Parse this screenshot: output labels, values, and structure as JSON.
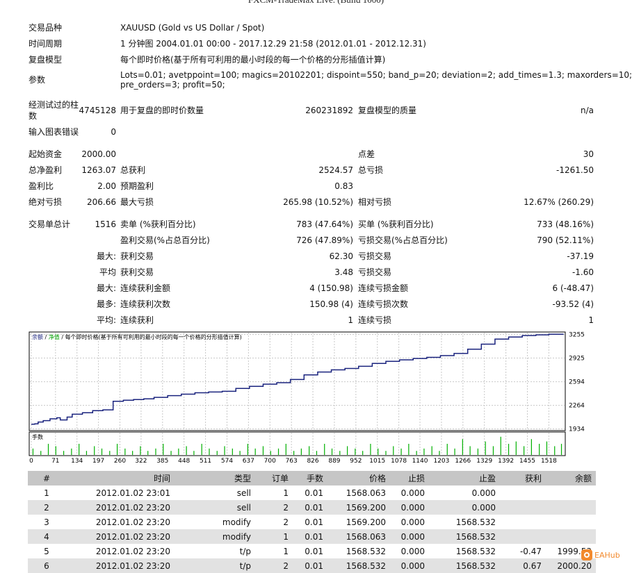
{
  "header": {
    "title": "FXCM-TradeMax Live. (Build 1000)"
  },
  "info": {
    "symbol_label": "交易品种",
    "symbol_value": "XAUUSD (Gold vs US Dollar / Spot)",
    "period_label": "时间周期",
    "period_value": "1 分钟图 2004.01.01 00:00 - 2017.12.29 21:58 (2012.01.01 - 2012.12.31)",
    "model_label": "复盘模型",
    "model_value": "每个即时价格(基于所有可利用的最小时段的每一个价格的分形插值计算)",
    "params_label": "参数",
    "params_line1": "Lots=0.01; avetppoint=100; magics=20102201; dispoint=550; band_p=20; deviation=2; add_times=1.3; maxorders=10;",
    "params_line2": "pre_orders=3; profit=50;"
  },
  "stats": {
    "bars_label_1": "经测试过的柱",
    "bars_label_2": "数",
    "bars_value": "4745128",
    "ticks_label": "用于复盘的即时价数量",
    "ticks_value": "260231892",
    "quality_label": "复盘模型的质量",
    "quality_value": "n/a",
    "errors_label": "输入图表错误",
    "errors_value": "0",
    "deposit_label": "起始资金",
    "deposit_value": "2000.00",
    "spread_label": "点差",
    "spread_value": "30",
    "net_label": "总净盈利",
    "net_value": "1263.07",
    "gross_profit_label": "总获利",
    "gross_profit_value": "2524.57",
    "gross_loss_label": "总亏损",
    "gross_loss_value": "-1261.50",
    "pf_label": "盈利比",
    "pf_value": "2.00",
    "payoff_label": "预期盈利",
    "payoff_value": "0.83",
    "abs_dd_label": "绝对亏损",
    "abs_dd_value": "206.66",
    "max_dd_label": "最大亏损",
    "max_dd_value": "265.98 (10.52%)",
    "rel_dd_label": "相对亏损",
    "rel_dd_value": "12.67% (260.29)",
    "trades_label": "交易单总计",
    "trades_value": "1516",
    "short_label": "卖单 (%获利百分比)",
    "short_value": "783 (47.64%)",
    "long_label": "买单 (%获利百分比)",
    "long_value": "733 (48.16%)",
    "profit_trades_label": "盈利交易(%占总百分比)",
    "profit_trades_value": "726 (47.89%)",
    "loss_trades_label": "亏损交易(%占总百分比)",
    "loss_trades_value": "790 (52.11%)",
    "largest_label": "最大:",
    "largest_profit_label": "获利交易",
    "largest_profit_value": "62.30",
    "largest_loss_label": "亏损交易",
    "largest_loss_value": "-37.19",
    "average_label": "平均",
    "average_profit_label": "获利交易",
    "average_profit_value": "3.48",
    "average_loss_label": "亏损交易",
    "average_loss_value": "-1.60",
    "max_label": "最大:",
    "max_consec_wins_label": "连续获利金额",
    "max_consec_wins_value": "4 (150.98)",
    "max_consec_losses_label": "连续亏损金额",
    "max_consec_losses_value": "6 (-48.47)",
    "maximal_label": "最多:",
    "maximal_wins_label": "连续获利次数",
    "maximal_wins_value": "150.98 (4)",
    "maximal_losses_label": "连续亏损次数",
    "maximal_losses_value": "-93.52 (4)",
    "avg_consec_label": "平均:",
    "avg_consec_wins_label": "连续获利",
    "avg_consec_wins_value": "1",
    "avg_consec_losses_label": "连续亏损",
    "avg_consec_losses_value": "1"
  },
  "chart_data": {
    "type": "line",
    "legend_balance": "余额",
    "legend_sep1": " / ",
    "legend_equity": "净值",
    "legend_sep2": " / ",
    "legend_model": "每个即时价格(基于所有可利用的最小时段的每一个价格的分形插值计算)",
    "volume_label": "手数",
    "xlim": [
      0,
      1560
    ],
    "ylim": [
      1910,
      3290
    ],
    "y_ticks": [
      3255,
      2925,
      2594,
      2264,
      1934
    ],
    "x_ticks": [
      0,
      71,
      134,
      197,
      260,
      322,
      385,
      448,
      511,
      574,
      637,
      700,
      763,
      826,
      889,
      952,
      1015,
      1078,
      1140,
      1203,
      1266,
      1329,
      1392,
      1455,
      1518
    ],
    "colors": {
      "balance": "#1a237e",
      "volume": "#00b000",
      "grid": "#c8c8c8",
      "legend_balance": "#1a237e",
      "legend_equity": "#00a000"
    },
    "series": [
      {
        "name": "余额",
        "x": [
          0,
          10,
          20,
          35,
          55,
          75,
          85,
          105,
          120,
          150,
          180,
          210,
          240,
          270,
          300,
          330,
          360,
          400,
          440,
          480,
          520,
          560,
          600,
          640,
          680,
          720,
          760,
          800,
          840,
          880,
          920,
          960,
          1000,
          1040,
          1080,
          1120,
          1160,
          1200,
          1240,
          1280,
          1320,
          1360,
          1400,
          1440,
          1480,
          1518,
          1560
        ],
        "y": [
          2000,
          2005,
          2030,
          2050,
          2075,
          2090,
          2060,
          2100,
          2140,
          2160,
          2190,
          2200,
          2320,
          2335,
          2345,
          2355,
          2375,
          2400,
          2420,
          2440,
          2450,
          2460,
          2500,
          2530,
          2560,
          2580,
          2625,
          2690,
          2730,
          2760,
          2780,
          2810,
          2850,
          2880,
          2900,
          2920,
          2935,
          2960,
          2990,
          3050,
          3120,
          3190,
          3220,
          3240,
          3250,
          3258,
          3265
        ]
      }
    ],
    "volume": {
      "ylim": [
        0,
        0.1
      ],
      "x": [
        5,
        28,
        50,
        72,
        95,
        118,
        140,
        162,
        185,
        207,
        230,
        252,
        275,
        297,
        320,
        342,
        365,
        387,
        410,
        432,
        455,
        477,
        500,
        522,
        545,
        567,
        590,
        612,
        635,
        657,
        680,
        702,
        725,
        747,
        770,
        792,
        815,
        837,
        860,
        882,
        905,
        927,
        950,
        972,
        995,
        1017,
        1040,
        1062,
        1085,
        1107,
        1130,
        1152,
        1175,
        1197,
        1220,
        1242,
        1265,
        1287,
        1310,
        1332,
        1355,
        1377,
        1400,
        1422,
        1445,
        1467,
        1490,
        1512,
        1535,
        1555
      ],
      "y": [
        0.03,
        0.02,
        0.05,
        0.04,
        0.02,
        0.03,
        0.05,
        0.02,
        0.04,
        0.03,
        0.02,
        0.05,
        0.03,
        0.02,
        0.04,
        0.02,
        0.03,
        0.05,
        0.02,
        0.03,
        0.04,
        0.02,
        0.05,
        0.03,
        0.02,
        0.04,
        0.03,
        0.02,
        0.05,
        0.03,
        0.04,
        0.02,
        0.03,
        0.05,
        0.02,
        0.03,
        0.04,
        0.02,
        0.05,
        0.03,
        0.02,
        0.04,
        0.03,
        0.02,
        0.05,
        0.03,
        0.02,
        0.04,
        0.03,
        0.05,
        0.02,
        0.03,
        0.04,
        0.02,
        0.05,
        0.03,
        0.07,
        0.04,
        0.03,
        0.06,
        0.04,
        0.08,
        0.05,
        0.06,
        0.04,
        0.07,
        0.05,
        0.06,
        0.04,
        0.05
      ]
    }
  },
  "table": {
    "headers": [
      "#",
      "时间",
      "类型",
      "订单",
      "手数",
      "价格",
      "止损",
      "止盈",
      "获利",
      "余额"
    ],
    "rows": [
      [
        "1",
        "2012.01.02 23:01",
        "sell",
        "1",
        "0.01",
        "1568.063",
        "0.000",
        "0.000",
        "",
        ""
      ],
      [
        "2",
        "2012.01.02 23:20",
        "sell",
        "2",
        "0.01",
        "1569.200",
        "0.000",
        "0.000",
        "",
        ""
      ],
      [
        "3",
        "2012.01.02 23:20",
        "modify",
        "2",
        "0.01",
        "1569.200",
        "0.000",
        "1568.532",
        "",
        ""
      ],
      [
        "4",
        "2012.01.02 23:20",
        "modify",
        "1",
        "0.01",
        "1568.063",
        "0.000",
        "1568.532",
        "",
        ""
      ],
      [
        "5",
        "2012.01.02 23:20",
        "t/p",
        "1",
        "0.01",
        "1568.532",
        "0.000",
        "1568.532",
        "-0.47",
        "1999.53"
      ],
      [
        "6",
        "2012.01.02 23:20",
        "t/p",
        "2",
        "0.01",
        "1568.532",
        "0.000",
        "1568.532",
        "0.67",
        "2000.20"
      ]
    ]
  },
  "watermark": {
    "text": "EAHub"
  }
}
